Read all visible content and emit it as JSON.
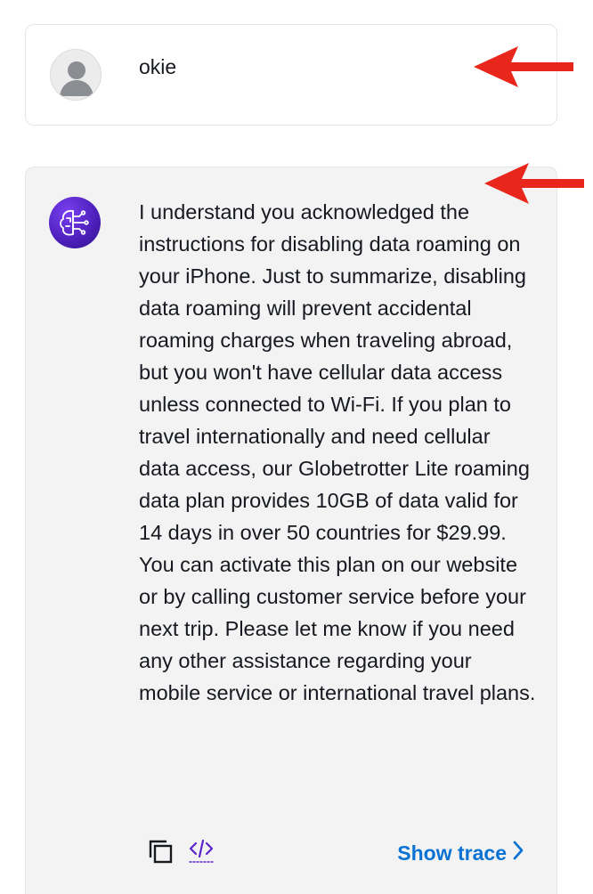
{
  "messages": {
    "user": {
      "text": "okie",
      "avatar_icon": "user-avatar-icon"
    },
    "assistant": {
      "text": "I understand you acknowledged the instructions for disabling data roaming on your iPhone. Just to summarize, disabling data roaming will prevent accidental roaming charges when traveling abroad, but you won't have cellular data access unless connected to Wi-Fi. If you plan to travel internationally and need cellular data access, our Globetrotter Lite roaming data plan provides 10GB of data valid for 14 days in over 50 countries for $29.99. You can activate this plan on our website or by calling customer service before your next trip. Please let me know if you need any other assistance regarding your mobile service or international travel plans.",
      "avatar_icon": "ai-brain-avatar-icon",
      "actions": {
        "copy_icon": "copy-icon",
        "code_icon": "code-icon",
        "show_trace_label": "Show trace"
      }
    }
  },
  "colors": {
    "link": "#0972d3",
    "arrow": "#e8261c",
    "assistant_bg": "#f3f3f3",
    "avatar_purple": "#5a25c9"
  }
}
